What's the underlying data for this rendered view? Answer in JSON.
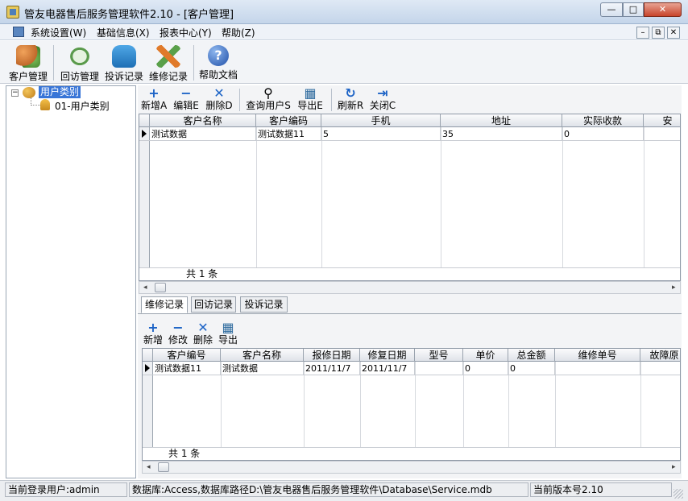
{
  "window": {
    "title": "管友电器售后服务管理软件2.10 - [客户管理]",
    "min_symbol": "—",
    "max_symbol": "□",
    "close_symbol": "✕"
  },
  "menu": [
    {
      "label": "系统设置(W)"
    },
    {
      "label": "基础信息(X)"
    },
    {
      "label": "报表中心(Y)"
    },
    {
      "label": "帮助(Z)"
    }
  ],
  "mdi_controls": {
    "min": "–",
    "restore": "⧉",
    "close": "✕"
  },
  "main_toolbar": [
    {
      "label": "客户管理",
      "icon": "users-icon"
    },
    {
      "label": "回访管理",
      "icon": "callback-icon"
    },
    {
      "label": "投诉记录",
      "icon": "hand-icon"
    },
    {
      "label": "维修记录",
      "icon": "tools-icon"
    },
    {
      "label": "帮助文档",
      "icon": "help-icon"
    }
  ],
  "tree": {
    "root": "用户类别",
    "expander": "−",
    "children": [
      "01-用户类别"
    ]
  },
  "customer_toolbar": [
    {
      "label": "新增A",
      "glyph": "+"
    },
    {
      "label": "编辑E",
      "glyph": "−"
    },
    {
      "label": "删除D",
      "glyph": "✕"
    },
    {
      "label": "查询用户S",
      "glyph": "⚲"
    },
    {
      "label": "导出E",
      "glyph": "▦"
    },
    {
      "label": "刷新R",
      "glyph": "↻"
    },
    {
      "label": "关闭C",
      "glyph": "⇥"
    }
  ],
  "customer_grid": {
    "columns": [
      "客户名称",
      "客户编码",
      "手机",
      "地址",
      "实际收款",
      "安"
    ],
    "rows": [
      [
        "测试数据",
        "测试数据11",
        "5",
        "35",
        "0",
        ""
      ]
    ],
    "footer": "共 1 条"
  },
  "tabs": [
    {
      "label": "维修记录",
      "active": true
    },
    {
      "label": "回访记录",
      "active": false
    },
    {
      "label": "投诉记录",
      "active": false
    }
  ],
  "detail_toolbar": [
    {
      "label": "新增",
      "glyph": "+"
    },
    {
      "label": "修改",
      "glyph": "−"
    },
    {
      "label": "删除",
      "glyph": "✕"
    },
    {
      "label": "导出",
      "glyph": "▦"
    }
  ],
  "repair_grid": {
    "columns": [
      "客户编号",
      "客户名称",
      "报修日期",
      "修复日期",
      "型号",
      "单价",
      "总金额",
      "维修单号",
      "故障原"
    ],
    "rows": [
      [
        "测试数据11",
        "测试数据",
        "2011/11/7",
        "2011/11/7",
        "",
        "0",
        "0",
        "",
        ""
      ]
    ],
    "footer": "共 1 条"
  },
  "scroll": {
    "left": "◂",
    "right": "▸"
  },
  "status": {
    "user": "当前登录用户:admin",
    "database": "数据库:Access,数据库路径D:\\管友电器售后服务管理软件\\Database\\Service.mdb",
    "version": "当前版本号2.10"
  }
}
